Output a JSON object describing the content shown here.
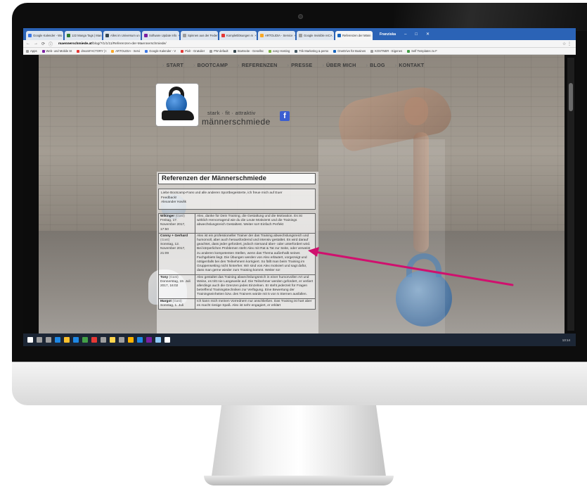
{
  "browser": {
    "tabs": [
      {
        "label": "Google Kalender - Wo",
        "color": "#3b78e7",
        "active": false
      },
      {
        "label": "122 Manga Tags | Man",
        "color": "#2e7d32",
        "active": false
      },
      {
        "label": "Alles im Universum un",
        "color": "#37474f",
        "active": false
      },
      {
        "label": "Software Update Info",
        "color": "#7b1fa2",
        "active": false
      },
      {
        "label": "Spinnen aus der Feder",
        "color": "#9e9e9e",
        "active": false
      },
      {
        "label": "Komplettlösungen m",
        "color": "#e53935",
        "active": false
      },
      {
        "label": "ARTOLIDIA - Service",
        "color": "#f9a825",
        "active": false
      },
      {
        "label": "Google Invisible reCA",
        "color": "#9e9e9e",
        "active": false
      },
      {
        "label": "Referenzen der Männ",
        "color": "#1565c0",
        "active": true
      }
    ],
    "owner": "Franziska",
    "url_domain": "maennerschmiede.at",
    "url_path": "/blog/?/1/1/11/Referenzen-der-Maennerschmiede/",
    "bookmarks": [
      {
        "label": "Apps",
        "color": "#9e9e9e"
      },
      {
        "label": "Web- und Mobile St",
        "color": "#7b1fa2"
      },
      {
        "label": "dreamFACTORY | t",
        "color": "#e53935"
      },
      {
        "label": "ARTOLIDIA - Servi",
        "color": "#f9a825"
      },
      {
        "label": "Google Kalender - V",
        "color": "#3b78e7"
      },
      {
        "label": "Pixlr - Gratulier",
        "color": "#e53935"
      },
      {
        "label": "PW default",
        "color": "#9e9e9e"
      },
      {
        "label": "Startseite - Gesellsc",
        "color": "#37474f"
      },
      {
        "label": "easy Hosting",
        "color": "#7cb342"
      },
      {
        "label": "Trik Marketing & perso",
        "color": "#455a64"
      },
      {
        "label": "OneDrive für Busines",
        "color": "#1565c0"
      },
      {
        "label": "KOSTNER - Eigenes",
        "color": "#9e9e9e"
      },
      {
        "label": "Self Templates zu F",
        "color": "#43a047"
      }
    ]
  },
  "site": {
    "nav": [
      "START",
      "BOOTCAMP",
      "REFERENZEN",
      "PRESSE",
      "ÜBER MICH",
      "BLOG",
      "KONTAKT"
    ],
    "slogan": "stark · fit · attraktiv",
    "brand": "männerschmiede",
    "facebook": "f",
    "heading": "Referenzen der Männerschmiede",
    "intro_lines": [
      "Liebe Bootcamp-Fans und alle anderen Sportbegeisterte, ich freue mich auf Euer",
      "Feedback!",
      "Alexander Havlik"
    ],
    "entries": [
      {
        "name": "Wikinger",
        "guest": "(Gast)",
        "date": "Freitag, 17. November 2017, 17:50",
        "text": "Alex, danke für Dein Training, die Gestaltung und die Motivation. Es ist wirklich Hervorragend wie du die Leute Motivierst und die Trainings abwechslungsreich Gestaltest. Weiter so!! Einfach Perfekt"
      },
      {
        "name": "Conny + Gerhard",
        "guest": "(Gast)",
        "date": "Sonntag, 12. November 2017, 21:09",
        "text": "Alex ist ein professioneller Trainer der das Training abwechslungsreich und humorvoll, aber auch herausfordernd und intensiv gestaltet. Es wird darauf geachtet, dass jeder gefordert, jedoch niemand über- oder unterfordert wird. Bei körperlichen Problemen steht Alex mit Rat & Tat zur Seite, oder verweist zu anderen kompetenten Stellen, wenn das Thema außerhalb seines Fachgebiets liegt. Die Übungen werden von Alex erläutert, vorgezeigt und nötigenfalls bei den Teilnehmern korrigiert. So fällt man beim Training im Gruppensetting nicht hinterher. Wir sind von Alex motiviert und sagt dafür, dass man gerne wieder zum Training kommt. Weiter so!"
      },
      {
        "name": "Tony",
        "guest": "(Gast)",
        "date": "Donnerstag, 19. Juli 2017, 16:02",
        "text": "Alex gestaltet das Training abwechslungsreich in einer humorvollen Art und Weise, es tritt nie Langeweile auf. Die Teilnehmer werden gefordert, er verliert allerdings auch die Grenzen jedes Einzelnen. Er steht jederzeit für Fragen betreffend Trainingstechniken zur Verfügung. Eine Bewertung der Trainingseinheiten bzw. des Trainers würde mit 5 von 5 Sternen ausfallen."
      },
      {
        "name": "Margot",
        "guest": "(Gast)",
        "date": "Sonntag, 1. Juli",
        "text": "Ich kann mich meinen Vorrednern nur anschließen. Das Training ist hart aber es macht riesige Spaß. Alex ist sehr engagiert, er erklärt"
      }
    ]
  },
  "taskbar": {
    "time": "13:14",
    "icons": [
      "#ffffff",
      "#9e9e9e",
      "#9e9e9e",
      "#1e88e5",
      "#fbc02d",
      "#1e88e5",
      "#43a047",
      "#e53935",
      "#9e9e9e",
      "#ffd54f",
      "#9e9e9e",
      "#ffb300",
      "#1e88e5",
      "#7b1fa2",
      "#90caf9",
      "#ffffff"
    ]
  },
  "annotation": {
    "color": "#d0106e"
  }
}
